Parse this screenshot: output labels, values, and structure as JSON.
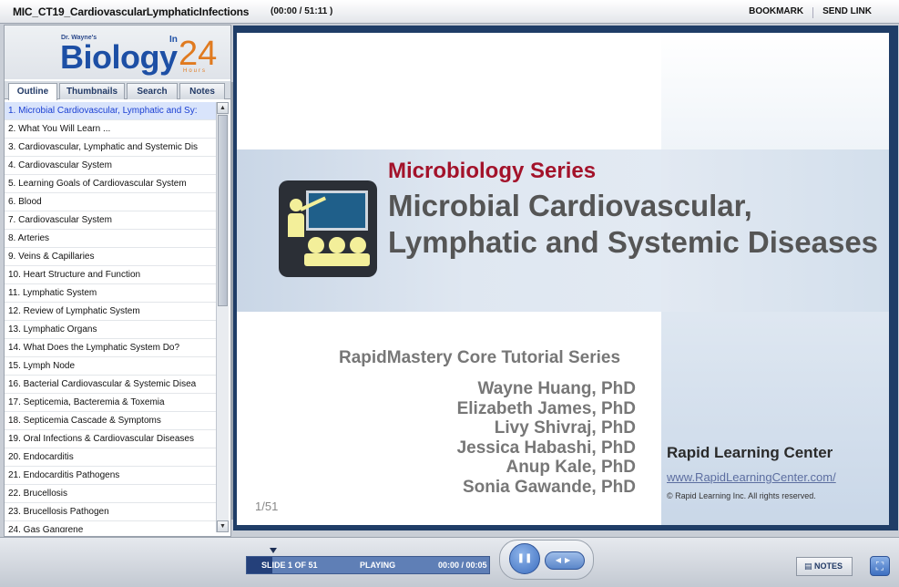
{
  "header": {
    "title": "MIC_CT19_CardiovascularLymphaticInfections",
    "time": "(00:00 / 51:11 )",
    "bookmark": "BOOKMARK",
    "send_link": "SEND LINK"
  },
  "logo": {
    "small": "Dr. Wayne's",
    "main": "Biology",
    "in": "In",
    "num": "24",
    "hours": "Hours"
  },
  "tabs": [
    "Outline",
    "Thumbnails",
    "Search",
    "Notes"
  ],
  "outline": [
    "1. Microbial Cardiovascular, Lymphatic and Sy:",
    "2. What You Will Learn ...",
    "3. Cardiovascular, Lymphatic and Systemic Dis",
    "4. Cardiovascular System",
    "5. Learning Goals of Cardiovascular System",
    "6. Blood",
    "7. Cardiovascular System",
    "8. Arteries",
    "9. Veins & Capillaries",
    "10. Heart Structure and Function",
    "11. Lymphatic System",
    "12. Review of Lymphatic System",
    "13. Lymphatic Organs",
    "14. What Does the Lymphatic System Do?",
    "15. Lymph Node",
    "16. Bacterial Cardiovascular & Systemic Disea",
    "17. Septicemia, Bacteremia & Toxemia",
    "18. Septicemia Cascade & Symptoms",
    "19. Oral Infections & Cardiovascular Diseases",
    "20. Endocarditis",
    "21. Endocarditis Pathogens",
    "22. Brucellosis",
    "23. Brucellosis Pathogen",
    "24. Gas Gangrene"
  ],
  "slide": {
    "series": "Microbiology Series",
    "title_line1": "Microbial Cardiovascular,",
    "title_line2": "Lymphatic and Systemic Diseases",
    "core": "RapidMastery Core Tutorial Series",
    "authors": [
      "Wayne Huang, PhD",
      "Elizabeth James, PhD",
      "Livy Shivraj, PhD",
      "Jessica Habashi, PhD",
      "Anup Kale, PhD",
      "Sonia Gawande, PhD"
    ],
    "page": "1/51",
    "center": "Rapid Learning Center",
    "url": "www.RapidLearningCenter.com/",
    "copyright": "© Rapid Learning Inc. All rights reserved."
  },
  "player": {
    "slide_label": "SLIDE 1 OF 51",
    "status": "PLAYING",
    "slide_time": "00:00 / 00:05",
    "notes": "NOTES"
  }
}
